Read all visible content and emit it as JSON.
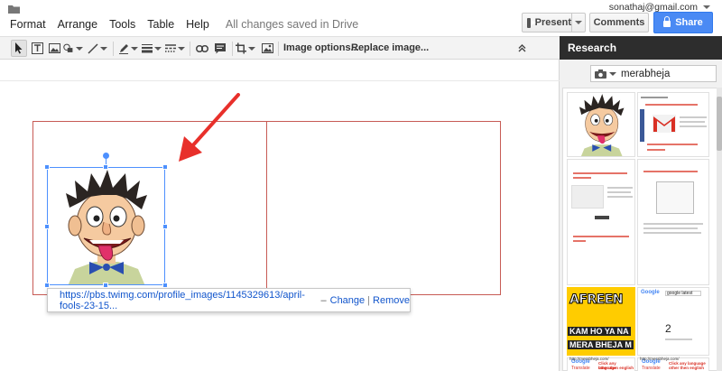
{
  "account": {
    "email": "sonathaj@gmail.com"
  },
  "menu": [
    "Format",
    "Arrange",
    "Tools",
    "Table",
    "Help"
  ],
  "save_status": "All changes saved in Drive",
  "buttons": {
    "present": "Present",
    "comments": "Comments",
    "share": "Share"
  },
  "toolbar": {
    "image_options": "Image options...",
    "replace_image": "Replace image..."
  },
  "link_bubble": {
    "url": "https://pbs.twimg.com/profile_images/1145329613/april-fools-23-15...",
    "separator": "–",
    "change": "Change",
    "pipe": "|",
    "remove": "Remove"
  },
  "research": {
    "title": "Research",
    "query": "merabheja",
    "thumb_text": {
      "afreen_1": "AFREEN",
      "afreen_2": "KAM HO YA NA",
      "afreen_3": "MERA BHEJA M",
      "google_1": "Google",
      "google_2": "Google",
      "google_3": "Google",
      "translate_1": "Translate",
      "translate_2": "Translate",
      "click_1": "Click any language",
      "click_2": "other then english",
      "click_3": "Click any language",
      "click_4": "other then english",
      "url_1": "http://merabheja.com/",
      "url_2": "http://merabheja.com/",
      "number": "2",
      "search_term": "google latest"
    }
  },
  "colors": {
    "accent_blue": "#4d90fe",
    "share_blue": "#4a8af4",
    "table_border": "#c75b55",
    "arrow_red": "#e8302b",
    "research_header": "#2d2d2d"
  },
  "icons": [
    "folder-icon",
    "cursor-icon",
    "textbox-icon",
    "image-icon",
    "shape-icon",
    "line-icon",
    "pen-icon",
    "line-weight-icon",
    "line-dash-icon",
    "link-icon",
    "comment-icon",
    "crop-icon",
    "mask-icon",
    "collapse-icon",
    "camera-icon",
    "lock-icon",
    "play-icon"
  ]
}
